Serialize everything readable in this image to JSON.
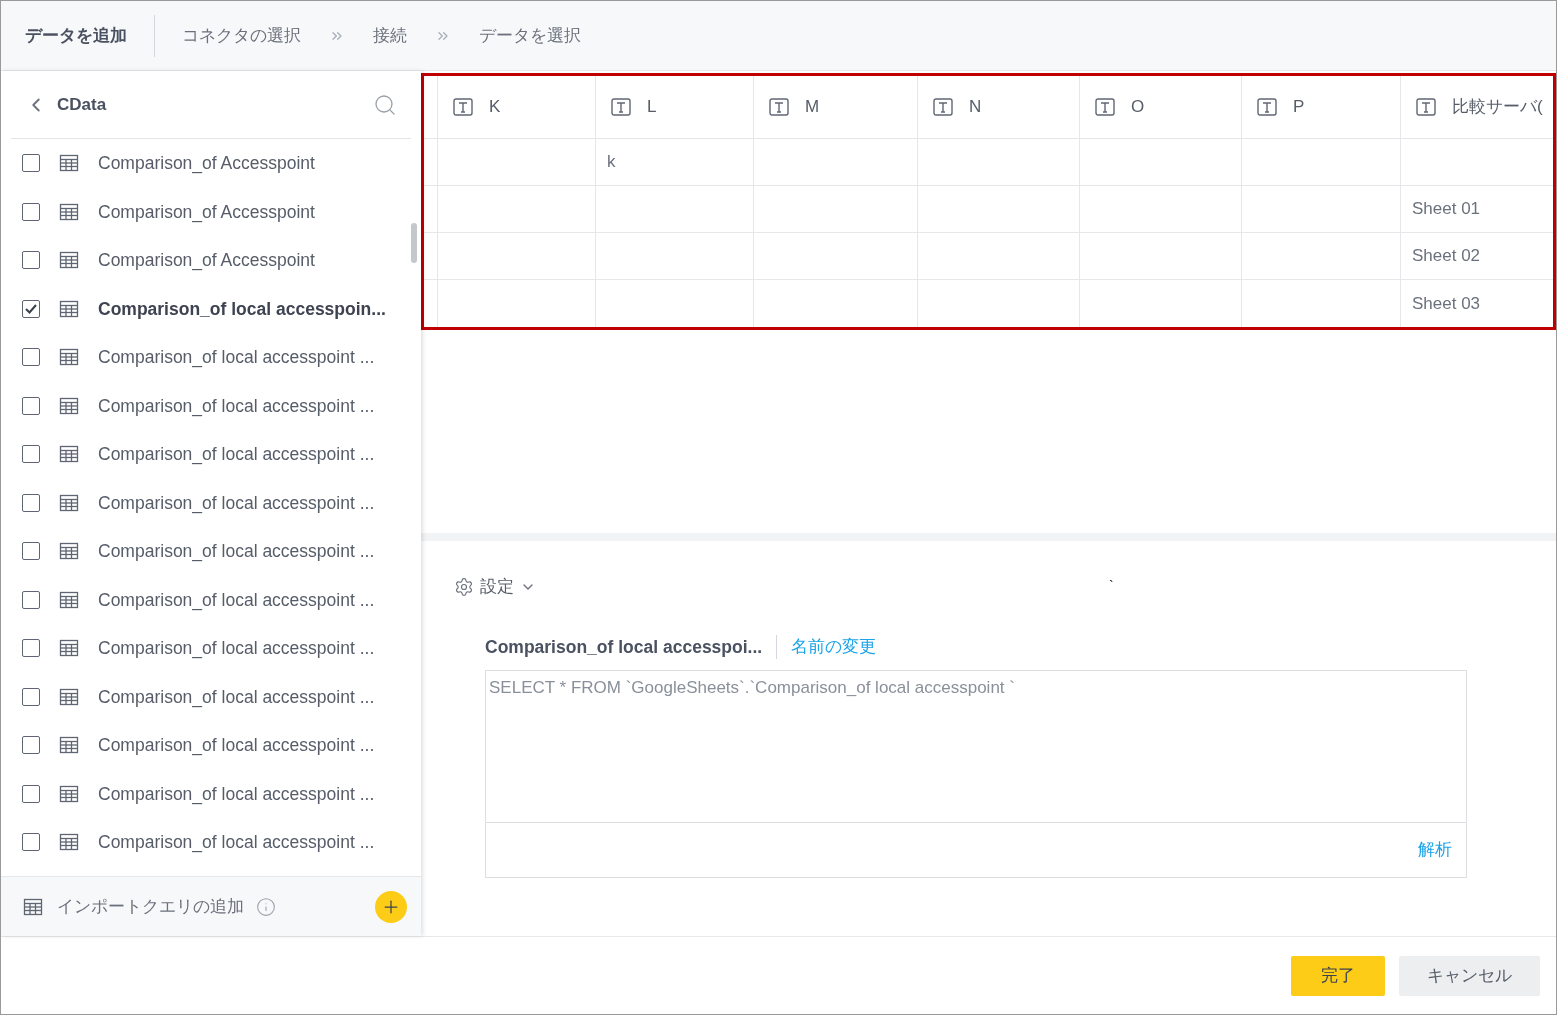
{
  "header": {
    "title": "データを追加",
    "steps": [
      "コネクタの選択",
      "接続",
      "データを選択"
    ]
  },
  "sidebar": {
    "title": "CData",
    "items": [
      {
        "label": "Comparison_of Accesspoint",
        "checked": false
      },
      {
        "label": "Comparison_of Accesspoint",
        "checked": false
      },
      {
        "label": "Comparison_of Accesspoint",
        "checked": false
      },
      {
        "label": "Comparison_of local accesspoin...",
        "checked": true
      },
      {
        "label": "Comparison_of local accesspoint ...",
        "checked": false
      },
      {
        "label": "Comparison_of local accesspoint ...",
        "checked": false
      },
      {
        "label": "Comparison_of local accesspoint ...",
        "checked": false
      },
      {
        "label": "Comparison_of local accesspoint ...",
        "checked": false
      },
      {
        "label": "Comparison_of local accesspoint ...",
        "checked": false
      },
      {
        "label": "Comparison_of local accesspoint ...",
        "checked": false
      },
      {
        "label": "Comparison_of local accesspoint ...",
        "checked": false
      },
      {
        "label": "Comparison_of local accesspoint ...",
        "checked": false
      },
      {
        "label": "Comparison_of local accesspoint ...",
        "checked": false
      },
      {
        "label": "Comparison_of local accesspoint ...",
        "checked": false
      },
      {
        "label": "Comparison_of local accesspoint ...",
        "checked": false
      }
    ],
    "footer_label": "インポートクエリの追加"
  },
  "table": {
    "columns": [
      "K",
      "L",
      "M",
      "N",
      "O",
      "P",
      "比較サーバ("
    ],
    "rows": [
      {
        "cells": [
          "",
          "k",
          "",
          "",
          "",
          "",
          ""
        ]
      },
      {
        "cells": [
          "",
          "",
          "",
          "",
          "",
          "",
          "Sheet 01"
        ]
      },
      {
        "cells": [
          "",
          "",
          "",
          "",
          "",
          "",
          "Sheet 02"
        ]
      },
      {
        "cells": [
          "",
          "",
          "",
          "",
          "",
          "",
          "Sheet 03"
        ]
      }
    ]
  },
  "settings": {
    "label": "設定",
    "stray_mark": "`",
    "query_name": "Comparison_of local accesspoi...",
    "rename_link": "名前の変更",
    "query": "SELECT * FROM `GoogleSheets`.`Comparison_of local accesspoint `",
    "parse_link": "解析"
  },
  "buttons": [
    {
      "label": "完了",
      "kind": "primary"
    },
    {
      "label": "キャンセル",
      "kind": "secondary"
    }
  ]
}
